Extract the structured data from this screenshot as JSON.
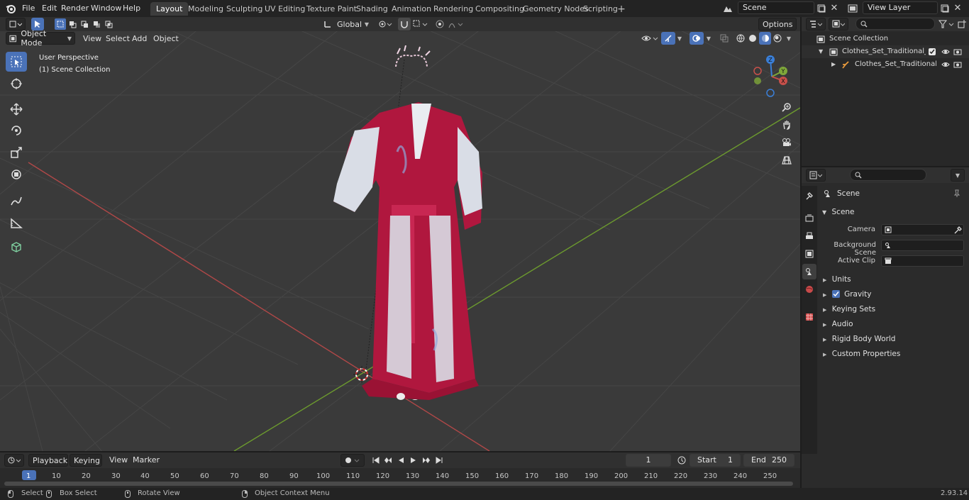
{
  "top_menu": {
    "file": "File",
    "edit": "Edit",
    "render": "Render",
    "window": "Window",
    "help": "Help"
  },
  "workspace_tabs": [
    "Layout",
    "Modeling",
    "Sculpting",
    "UV Editing",
    "Texture Paint",
    "Shading",
    "Animation",
    "Rendering",
    "Compositing",
    "Geometry Nodes",
    "Scripting"
  ],
  "active_tab": "Layout",
  "scene_name": "Scene",
  "view_layer": "View Layer",
  "viewport_header": {
    "mode": "Object Mode",
    "view": "View",
    "select": "Select",
    "add": "Add",
    "object": "Object",
    "orientation": "Global",
    "options": "Options"
  },
  "viewport_overlay": {
    "perspective": "User Perspective",
    "collection": "(1) Scene Collection"
  },
  "gizmo": {
    "x": "X",
    "y": "Y",
    "z": "Z"
  },
  "outliner": {
    "root": "Scene Collection",
    "items": [
      {
        "label": "Clothes_Set_Traditional_Chine"
      },
      {
        "label": "Clothes_Set_Traditional_("
      }
    ]
  },
  "properties": {
    "breadcrumb": "Scene",
    "section": "Scene",
    "fields": [
      {
        "label": "Camera",
        "value": ""
      },
      {
        "label": "Background Scene",
        "value": ""
      },
      {
        "label": "Active Clip",
        "value": ""
      }
    ],
    "panels": [
      "Units",
      "Gravity",
      "Keying Sets",
      "Audio",
      "Rigid Body World",
      "Custom Properties"
    ],
    "gravity_checked": true
  },
  "timeline": {
    "playback": "Playback",
    "keying": "Keying",
    "view": "View",
    "marker": "Marker",
    "current_frame": "1",
    "start_label": "Start",
    "start": "1",
    "end_label": "End",
    "end": "250",
    "ticks": [
      "1",
      "10",
      "20",
      "30",
      "40",
      "50",
      "60",
      "70",
      "80",
      "90",
      "100",
      "110",
      "120",
      "130",
      "140",
      "150",
      "160",
      "170",
      "180",
      "190",
      "200",
      "210",
      "220",
      "230",
      "240",
      "250"
    ]
  },
  "statusbar": {
    "select": "Select",
    "box_select": "Box Select",
    "rotate_view": "Rotate View",
    "context_menu": "Object Context Menu",
    "version": "2.93.14"
  },
  "colors": {
    "accent": "#4a72b8",
    "x_axis": "#c8504a",
    "y_axis": "#7fa83a",
    "z_axis": "#3a7fd8",
    "robe_red": "#b0173e",
    "robe_white": "#d9dde6"
  }
}
